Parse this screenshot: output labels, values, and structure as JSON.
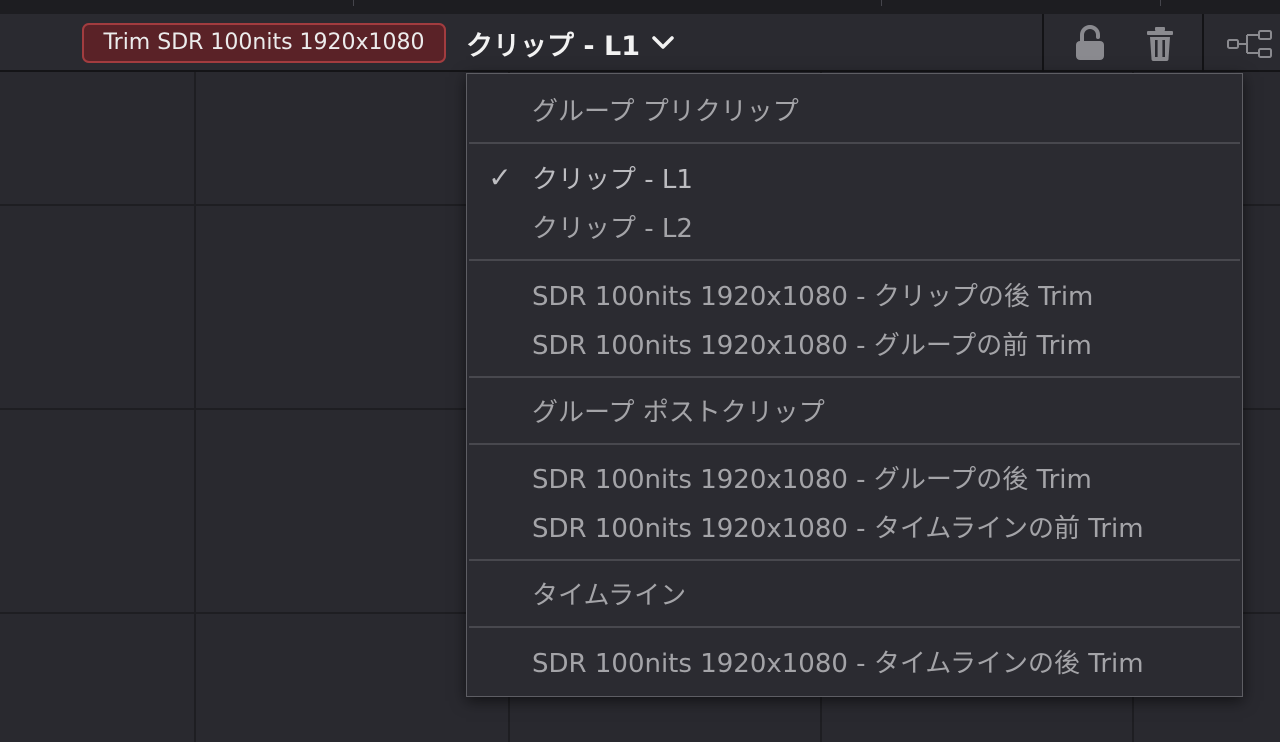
{
  "header": {
    "trim_badge_label": "Trim SDR 100nits 1920x1080",
    "clip_selector_label": "クリップ  -  L1",
    "icons": [
      "chevron-down-icon",
      "lock-icon",
      "trash-icon",
      "node-graph-icon"
    ]
  },
  "menu": {
    "items": [
      {
        "label": "グループ プリクリップ",
        "checked": false
      },
      {
        "label": "クリップ - L1",
        "checked": true
      },
      {
        "label": "クリップ - L2",
        "checked": false
      },
      {
        "label": "SDR 100nits 1920x1080 - クリップの後 Trim",
        "checked": false
      },
      {
        "label": "SDR 100nits 1920x1080 - グループの前 Trim",
        "checked": false
      },
      {
        "label": "グループ ポストクリップ",
        "checked": false
      },
      {
        "label": "SDR 100nits 1920x1080 - グループの後 Trim",
        "checked": false
      },
      {
        "label": "SDR 100nits 1920x1080 - タイムラインの前 Trim",
        "checked": false
      },
      {
        "label": "タイムライン",
        "checked": false
      },
      {
        "label": "SDR 100nits 1920x1080 - タイムラインの後 Trim",
        "checked": false
      }
    ],
    "check_glyph": "✓"
  },
  "colors": {
    "badge_border": "#a23c3f",
    "badge_fill": "#5a2227",
    "menu_bg": "#2b2b31",
    "menu_text": "#a4a4a8"
  }
}
